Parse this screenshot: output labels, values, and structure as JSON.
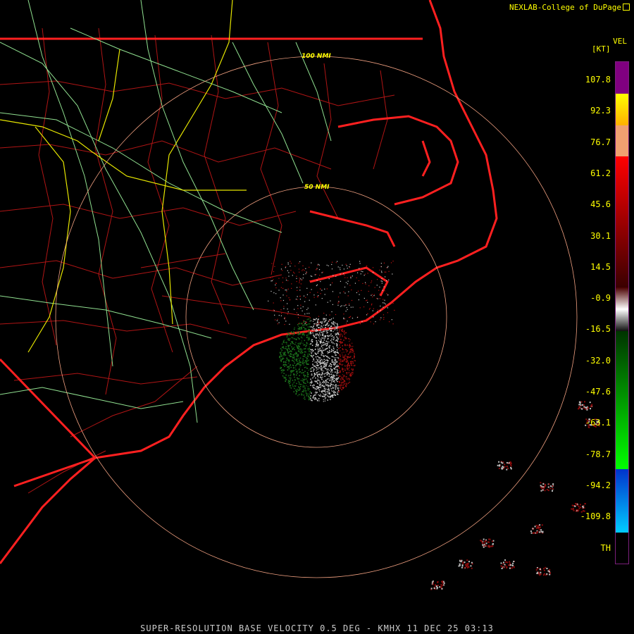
{
  "credit": "NEXLAB-College of DuPage",
  "legend": {
    "title": "VEL",
    "unit": "[KT]",
    "ticks": [
      "107.8",
      "92.3",
      "76.7",
      "61.2",
      "45.6",
      "30.1",
      "14.5",
      "-0.9",
      "-16.5",
      "-32.0",
      "-47.6",
      "-63.1",
      "-78.7",
      "-94.2",
      "-109.8",
      "TH"
    ],
    "colors": {
      "purple": "#800080",
      "yellow": "#ffff00",
      "orange": "#ff9966",
      "red_top": "#ff0000",
      "red_dark": "#5a0000",
      "gray": "#ffffff",
      "green_dark": "#003300",
      "green_bright": "#00ff00",
      "blue": "#0033cc",
      "cyan": "#00ccff",
      "black": "#000000"
    }
  },
  "rings": {
    "inner_label": "50 NMI",
    "outer_label": "100 NMI"
  },
  "footer": "SUPER-RESOLUTION BASE VELOCITY 0.5 DEG - KMHX 11 DEC 25 03:13",
  "map_colors": {
    "background": "#000000",
    "state_border": "#ff2a2a",
    "county": "#c01818",
    "highway": "#98e298",
    "interstate": "#e6e600",
    "ring": "#f0a080"
  }
}
